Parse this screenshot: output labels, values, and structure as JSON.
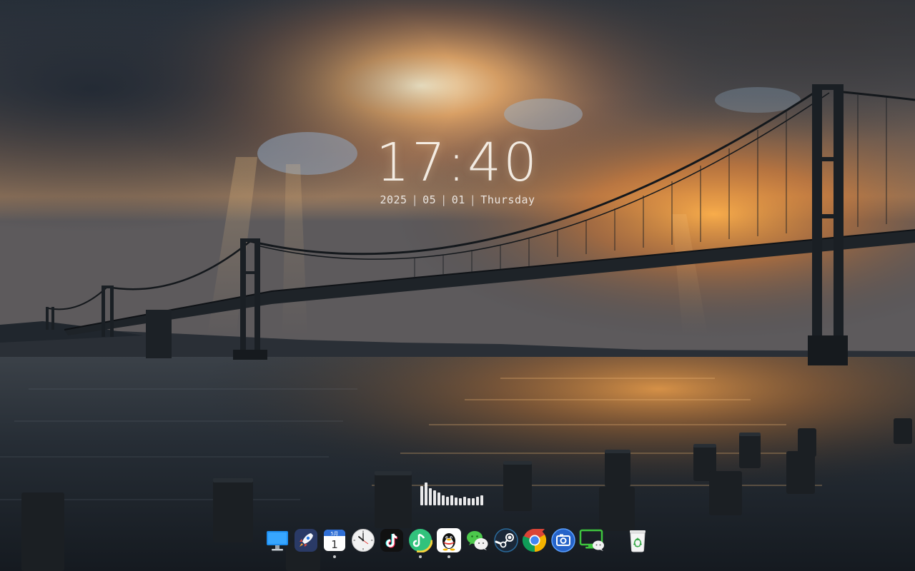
{
  "clock": {
    "time": "17:40",
    "year": "2025",
    "month": "05",
    "day": "01",
    "weekday": "Thursday",
    "separator": "|"
  },
  "calendar_icon": {
    "month_label": "5月",
    "day_label": "1"
  },
  "visualizer": {
    "levels": [
      0.78,
      0.95,
      0.7,
      0.62,
      0.52,
      0.42,
      0.36,
      0.4,
      0.33,
      0.3,
      0.34,
      0.3,
      0.28,
      0.36,
      0.42
    ]
  },
  "dock": {
    "items": [
      {
        "icon": "monitor-icon",
        "name": "dock-item-desktop"
      },
      {
        "icon": "rocket-icon",
        "name": "dock-item-launcher"
      },
      {
        "icon": "calendar-icon",
        "name": "dock-item-calendar"
      },
      {
        "icon": "clock-icon",
        "name": "dock-item-clock"
      },
      {
        "icon": "tiktok-icon",
        "name": "dock-item-tiktok"
      },
      {
        "icon": "qq-music-icon",
        "name": "dock-item-qq-music"
      },
      {
        "icon": "qq-penguin-icon",
        "name": "dock-item-qq"
      },
      {
        "icon": "wechat-icon",
        "name": "dock-item-wechat"
      },
      {
        "icon": "steam-icon",
        "name": "dock-item-steam"
      },
      {
        "icon": "chrome-icon",
        "name": "dock-item-chrome"
      },
      {
        "icon": "screenshot-icon",
        "name": "dock-item-screenshot"
      },
      {
        "icon": "wechat-desktop-icon",
        "name": "dock-item-wechat-desktop"
      },
      {
        "icon": "recycle-bin-icon",
        "name": "dock-item-trash"
      }
    ]
  },
  "colors": {
    "sky_top": "#2e3844",
    "sky_glow": "#f3a45a",
    "water": "#1f2a33",
    "sun_reflection": "#d9822e",
    "bridge": "#1e2328"
  }
}
